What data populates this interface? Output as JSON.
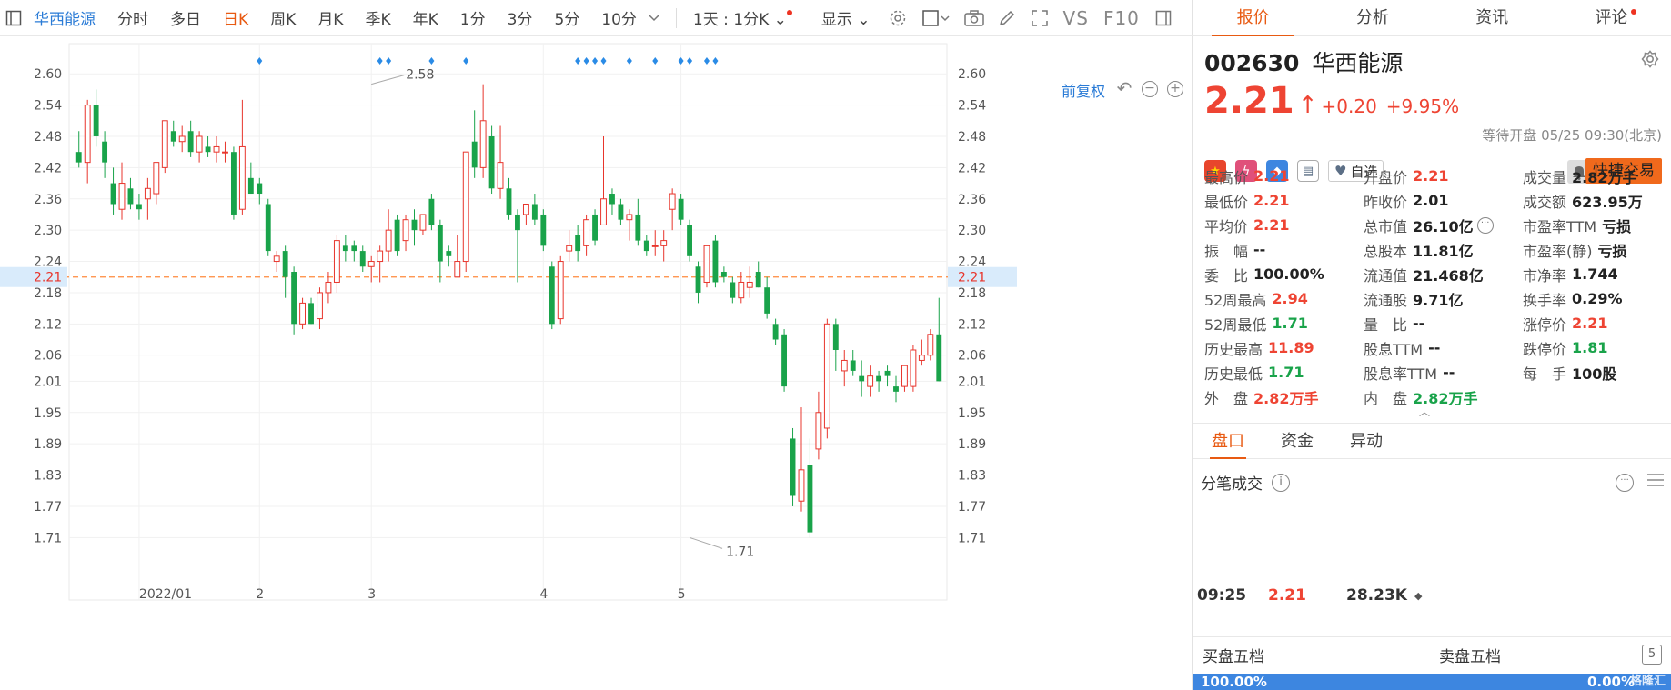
{
  "toolbar": {
    "stock_name": "华西能源",
    "periods": [
      "分时",
      "多日",
      "日K",
      "周K",
      "月K",
      "季K",
      "年K",
      "1分",
      "3分",
      "5分",
      "10分"
    ],
    "active_period": "日K",
    "multi_period": "1天 : 1分K",
    "display_label": "显示",
    "vs_label": "VS",
    "f10_label": "F10",
    "adjust_label": "前复权"
  },
  "chart_data": {
    "type": "candlestick",
    "security": "华西能源",
    "y_ticks": [
      2.6,
      2.54,
      2.48,
      2.42,
      2.36,
      2.3,
      2.24,
      2.18,
      2.12,
      2.06,
      2.01,
      1.95,
      1.89,
      1.83,
      1.77,
      1.71
    ],
    "y_range": [
      1.66,
      2.63
    ],
    "x_tick_labels": [
      "2022/01",
      "2",
      "3",
      "4",
      "5"
    ],
    "x_tick_index": [
      7,
      21,
      34,
      54,
      70
    ],
    "current_price": 2.21,
    "annotations": [
      {
        "text": "2.58",
        "index": 34,
        "value": 2.58
      },
      {
        "text": "1.71",
        "index": 71,
        "value": 1.71
      }
    ],
    "marker_index": [
      21,
      35,
      36,
      41,
      45,
      58,
      59,
      60,
      61,
      64,
      67,
      70,
      71,
      73,
      74
    ],
    "candles": [
      {
        "o": 2.45,
        "h": 2.49,
        "l": 2.42,
        "c": 2.43
      },
      {
        "o": 2.43,
        "h": 2.55,
        "l": 2.39,
        "c": 2.54
      },
      {
        "o": 2.54,
        "h": 2.57,
        "l": 2.46,
        "c": 2.48
      },
      {
        "o": 2.47,
        "h": 2.49,
        "l": 2.4,
        "c": 2.43
      },
      {
        "o": 2.39,
        "h": 2.42,
        "l": 2.33,
        "c": 2.35
      },
      {
        "o": 2.34,
        "h": 2.43,
        "l": 2.32,
        "c": 2.39
      },
      {
        "o": 2.38,
        "h": 2.4,
        "l": 2.34,
        "c": 2.35
      },
      {
        "o": 2.35,
        "h": 2.37,
        "l": 2.32,
        "c": 2.34
      },
      {
        "o": 2.36,
        "h": 2.4,
        "l": 2.32,
        "c": 2.38
      },
      {
        "o": 2.37,
        "h": 2.43,
        "l": 2.35,
        "c": 2.43
      },
      {
        "o": 2.42,
        "h": 2.51,
        "l": 2.41,
        "c": 2.51
      },
      {
        "o": 2.49,
        "h": 2.51,
        "l": 2.46,
        "c": 2.47
      },
      {
        "o": 2.47,
        "h": 2.5,
        "l": 2.45,
        "c": 2.48
      },
      {
        "o": 2.49,
        "h": 2.51,
        "l": 2.44,
        "c": 2.45
      },
      {
        "o": 2.45,
        "h": 2.49,
        "l": 2.43,
        "c": 2.48
      },
      {
        "o": 2.46,
        "h": 2.48,
        "l": 2.44,
        "c": 2.45
      },
      {
        "o": 2.45,
        "h": 2.48,
        "l": 2.43,
        "c": 2.46
      },
      {
        "o": 2.45,
        "h": 2.47,
        "l": 2.43,
        "c": 2.45
      },
      {
        "o": 2.45,
        "h": 2.46,
        "l": 2.32,
        "c": 2.33
      },
      {
        "o": 2.34,
        "h": 2.55,
        "l": 2.33,
        "c": 2.46
      },
      {
        "o": 2.4,
        "h": 2.43,
        "l": 2.37,
        "c": 2.37
      },
      {
        "o": 2.39,
        "h": 2.4,
        "l": 2.35,
        "c": 2.37
      },
      {
        "o": 2.35,
        "h": 2.36,
        "l": 2.25,
        "c": 2.26
      },
      {
        "o": 2.24,
        "h": 2.26,
        "l": 2.22,
        "c": 2.25
      },
      {
        "o": 2.26,
        "h": 2.27,
        "l": 2.17,
        "c": 2.21
      },
      {
        "o": 2.22,
        "h": 2.23,
        "l": 2.1,
        "c": 2.12
      },
      {
        "o": 2.12,
        "h": 2.17,
        "l": 2.11,
        "c": 2.16
      },
      {
        "o": 2.16,
        "h": 2.17,
        "l": 2.12,
        "c": 2.12
      },
      {
        "o": 2.13,
        "h": 2.19,
        "l": 2.11,
        "c": 2.18
      },
      {
        "o": 2.18,
        "h": 2.22,
        "l": 2.16,
        "c": 2.2
      },
      {
        "o": 2.2,
        "h": 2.29,
        "l": 2.18,
        "c": 2.28
      },
      {
        "o": 2.27,
        "h": 2.29,
        "l": 2.24,
        "c": 2.26
      },
      {
        "o": 2.27,
        "h": 2.28,
        "l": 2.24,
        "c": 2.26
      },
      {
        "o": 2.26,
        "h": 2.27,
        "l": 2.22,
        "c": 2.23
      },
      {
        "o": 2.23,
        "h": 2.25,
        "l": 2.2,
        "c": 2.24
      },
      {
        "o": 2.24,
        "h": 2.27,
        "l": 2.2,
        "c": 2.26
      },
      {
        "o": 2.26,
        "h": 2.34,
        "l": 2.24,
        "c": 2.3
      },
      {
        "o": 2.32,
        "h": 2.33,
        "l": 2.25,
        "c": 2.26
      },
      {
        "o": 2.28,
        "h": 2.33,
        "l": 2.26,
        "c": 2.32
      },
      {
        "o": 2.32,
        "h": 2.34,
        "l": 2.27,
        "c": 2.3
      },
      {
        "o": 2.3,
        "h": 2.33,
        "l": 2.29,
        "c": 2.33
      },
      {
        "o": 2.36,
        "h": 2.37,
        "l": 2.3,
        "c": 2.31
      },
      {
        "o": 2.31,
        "h": 2.32,
        "l": 2.2,
        "c": 2.24
      },
      {
        "o": 2.26,
        "h": 2.27,
        "l": 2.23,
        "c": 2.25
      },
      {
        "o": 2.21,
        "h": 2.29,
        "l": 2.21,
        "c": 2.24
      },
      {
        "o": 2.24,
        "h": 2.45,
        "l": 2.22,
        "c": 2.45
      },
      {
        "o": 2.47,
        "h": 2.53,
        "l": 2.4,
        "c": 2.42
      },
      {
        "o": 2.42,
        "h": 2.58,
        "l": 2.4,
        "c": 2.51
      },
      {
        "o": 2.48,
        "h": 2.5,
        "l": 2.37,
        "c": 2.38
      },
      {
        "o": 2.38,
        "h": 2.5,
        "l": 2.36,
        "c": 2.43
      },
      {
        "o": 2.38,
        "h": 2.4,
        "l": 2.32,
        "c": 2.33
      },
      {
        "o": 2.33,
        "h": 2.34,
        "l": 2.2,
        "c": 2.3
      },
      {
        "o": 2.33,
        "h": 2.35,
        "l": 2.31,
        "c": 2.35
      },
      {
        "o": 2.35,
        "h": 2.37,
        "l": 2.31,
        "c": 2.32
      },
      {
        "o": 2.33,
        "h": 2.34,
        "l": 2.26,
        "c": 2.27
      },
      {
        "o": 2.23,
        "h": 2.24,
        "l": 2.11,
        "c": 2.12
      },
      {
        "o": 2.13,
        "h": 2.25,
        "l": 2.12,
        "c": 2.24
      },
      {
        "o": 2.26,
        "h": 2.3,
        "l": 2.24,
        "c": 2.27
      },
      {
        "o": 2.29,
        "h": 2.31,
        "l": 2.24,
        "c": 2.26
      },
      {
        "o": 2.27,
        "h": 2.33,
        "l": 2.25,
        "c": 2.32
      },
      {
        "o": 2.33,
        "h": 2.34,
        "l": 2.27,
        "c": 2.28
      },
      {
        "o": 2.31,
        "h": 2.48,
        "l": 2.31,
        "c": 2.36
      },
      {
        "o": 2.37,
        "h": 2.38,
        "l": 2.33,
        "c": 2.35
      },
      {
        "o": 2.35,
        "h": 2.36,
        "l": 2.31,
        "c": 2.32
      },
      {
        "o": 2.32,
        "h": 2.34,
        "l": 2.28,
        "c": 2.33
      },
      {
        "o": 2.33,
        "h": 2.36,
        "l": 2.27,
        "c": 2.28
      },
      {
        "o": 2.28,
        "h": 2.29,
        "l": 2.25,
        "c": 2.26
      },
      {
        "o": 2.27,
        "h": 2.3,
        "l": 2.25,
        "c": 2.27
      },
      {
        "o": 2.27,
        "h": 2.3,
        "l": 2.24,
        "c": 2.28
      },
      {
        "o": 2.34,
        "h": 2.38,
        "l": 2.3,
        "c": 2.37
      },
      {
        "o": 2.36,
        "h": 2.37,
        "l": 2.31,
        "c": 2.32
      },
      {
        "o": 2.31,
        "h": 2.32,
        "l": 2.24,
        "c": 2.25
      },
      {
        "o": 2.23,
        "h": 2.24,
        "l": 2.16,
        "c": 2.18
      },
      {
        "o": 2.2,
        "h": 2.27,
        "l": 2.19,
        "c": 2.27
      },
      {
        "o": 2.28,
        "h": 2.29,
        "l": 2.19,
        "c": 2.2
      },
      {
        "o": 2.22,
        "h": 2.23,
        "l": 2.2,
        "c": 2.21
      },
      {
        "o": 2.2,
        "h": 2.21,
        "l": 2.16,
        "c": 2.17
      },
      {
        "o": 2.17,
        "h": 2.22,
        "l": 2.16,
        "c": 2.2
      },
      {
        "o": 2.19,
        "h": 2.23,
        "l": 2.17,
        "c": 2.2
      },
      {
        "o": 2.22,
        "h": 2.24,
        "l": 2.19,
        "c": 2.19
      },
      {
        "o": 2.19,
        "h": 2.21,
        "l": 2.13,
        "c": 2.14
      },
      {
        "o": 2.12,
        "h": 2.13,
        "l": 2.08,
        "c": 2.09
      },
      {
        "o": 2.1,
        "h": 2.11,
        "l": 1.99,
        "c": 2.0
      },
      {
        "o": 1.9,
        "h": 1.92,
        "l": 1.77,
        "c": 1.79
      },
      {
        "o": 1.78,
        "h": 1.96,
        "l": 1.76,
        "c": 1.84
      },
      {
        "o": 1.85,
        "h": 1.9,
        "l": 1.71,
        "c": 1.72
      },
      {
        "o": 1.88,
        "h": 1.99,
        "l": 1.86,
        "c": 1.95
      },
      {
        "o": 1.92,
        "h": 2.13,
        "l": 1.9,
        "c": 2.12
      },
      {
        "o": 2.12,
        "h": 2.13,
        "l": 2.03,
        "c": 2.07
      },
      {
        "o": 2.03,
        "h": 2.07,
        "l": 2.0,
        "c": 2.05
      },
      {
        "o": 2.05,
        "h": 2.07,
        "l": 2.02,
        "c": 2.03
      },
      {
        "o": 2.02,
        "h": 2.05,
        "l": 1.98,
        "c": 2.01
      },
      {
        "o": 2.0,
        "h": 2.04,
        "l": 1.98,
        "c": 2.02
      },
      {
        "o": 2.02,
        "h": 2.03,
        "l": 1.99,
        "c": 2.01
      },
      {
        "o": 2.03,
        "h": 2.04,
        "l": 2.0,
        "c": 2.02
      },
      {
        "o": 2.0,
        "h": 2.02,
        "l": 1.97,
        "c": 1.99
      },
      {
        "o": 2.0,
        "h": 2.04,
        "l": 1.99,
        "c": 2.04
      },
      {
        "o": 2.0,
        "h": 2.08,
        "l": 1.99,
        "c": 2.07
      },
      {
        "o": 2.05,
        "h": 2.09,
        "l": 2.04,
        "c": 2.06
      },
      {
        "o": 2.06,
        "h": 2.11,
        "l": 2.05,
        "c": 2.1
      },
      {
        "o": 2.1,
        "h": 2.17,
        "l": 2.01,
        "c": 2.01
      }
    ]
  },
  "tabs": [
    "报价",
    "分析",
    "资讯",
    "评论"
  ],
  "quote": {
    "code": "002630",
    "name": "华西能源",
    "price": "2.21",
    "change": "+0.20",
    "change_pct": "+9.95%",
    "status": "等待开盘 05/25 09:30(北京)",
    "watch_label": "自选",
    "trade_label": "快捷交易",
    "icons": [
      "china-flag-icon",
      "lightning-icon",
      "tag-icon",
      "bookmark-icon"
    ],
    "icon_colors": [
      "#e8452c",
      "#e0507a",
      "#3d86e0",
      "#5c6f86"
    ]
  },
  "stats": [
    [
      {
        "k": "最高价",
        "v": "2.21",
        "c": "red"
      },
      {
        "k": "开盘价",
        "v": "2.21",
        "c": "red"
      },
      {
        "k": "成交量",
        "v": "2.82万手",
        "c": ""
      }
    ],
    [
      {
        "k": "最低价",
        "v": "2.21",
        "c": "red"
      },
      {
        "k": "昨收价",
        "v": "2.01",
        "c": ""
      },
      {
        "k": "成交额",
        "v": "623.95万",
        "c": ""
      }
    ],
    [
      {
        "k": "平均价",
        "v": "2.21",
        "c": "red"
      },
      {
        "k": "总市值",
        "v": "26.10亿",
        "c": ""
      },
      {
        "k": "市盈率TTM",
        "v": "亏损",
        "c": ""
      }
    ],
    [
      {
        "k": "振　幅",
        "v": "--",
        "c": ""
      },
      {
        "k": "总股本",
        "v": "11.81亿",
        "c": ""
      },
      {
        "k": "市盈率(静)",
        "v": "亏损",
        "c": ""
      }
    ],
    [
      {
        "k": "委　比",
        "v": "100.00%",
        "c": ""
      },
      {
        "k": "流通值",
        "v": "21.468亿",
        "c": ""
      },
      {
        "k": "市净率",
        "v": "1.744",
        "c": ""
      }
    ],
    [
      {
        "k": "52周最高",
        "v": "2.94",
        "c": "red"
      },
      {
        "k": "流通股",
        "v": "9.71亿",
        "c": ""
      },
      {
        "k": "换手率",
        "v": "0.29%",
        "c": ""
      }
    ],
    [
      {
        "k": "52周最低",
        "v": "1.71",
        "c": "green"
      },
      {
        "k": "量　比",
        "v": "--",
        "c": ""
      },
      {
        "k": "涨停价",
        "v": "2.21",
        "c": "red"
      }
    ],
    [
      {
        "k": "历史最高",
        "v": "11.89",
        "c": "red"
      },
      {
        "k": "股息TTM",
        "v": "--",
        "c": ""
      },
      {
        "k": "跌停价",
        "v": "1.81",
        "c": "green"
      }
    ],
    [
      {
        "k": "历史最低",
        "v": "1.71",
        "c": "green"
      },
      {
        "k": "股息率TTM",
        "v": "--",
        "c": ""
      },
      {
        "k": "每　手",
        "v": "100股",
        "c": ""
      }
    ],
    [
      {
        "k": "外　盘",
        "v": "2.82万手",
        "c": "red"
      },
      {
        "k": "内　盘",
        "v": "2.82万手",
        "c": "green"
      },
      {
        "k": "",
        "v": "",
        "c": ""
      }
    ]
  ],
  "subtabs": [
    "盘口",
    "资金",
    "异动"
  ],
  "ticks": {
    "title": "分笔成交",
    "rows": [
      {
        "time": "09:25",
        "price": "2.21",
        "vol": "28.23K"
      }
    ]
  },
  "book": {
    "bid_label": "买盘五档",
    "ask_label": "卖盘五档",
    "five_label": "5",
    "bid_pct": "100.00%",
    "ask_pct": "0.00%",
    "watermark": "格隆汇"
  },
  "colors": {
    "up": "#e8352c",
    "down": "#19a34a",
    "accent": "#e85a12",
    "link": "#2a7bd6",
    "marker": "#2a8be6"
  }
}
